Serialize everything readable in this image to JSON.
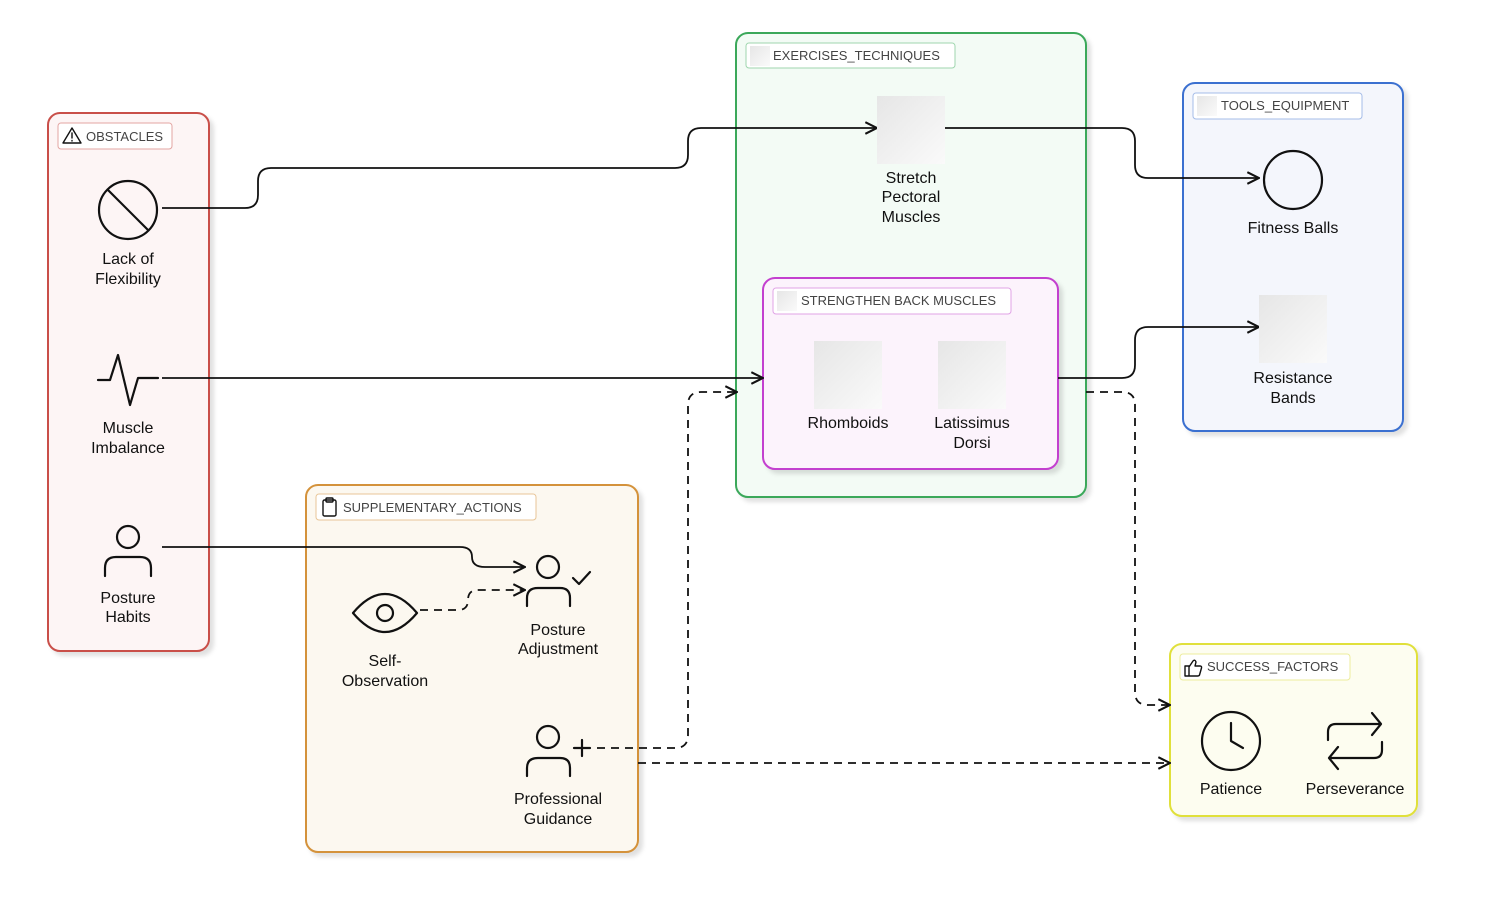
{
  "groups": {
    "obstacles": {
      "title": "OBSTACLES",
      "color": "#c9504a"
    },
    "exercises": {
      "title": "EXERCISES_TECHNIQUES",
      "color": "#3aa85a"
    },
    "strengthen": {
      "title": "STRENGTHEN BACK MUSCLES",
      "color": "#c33fcf"
    },
    "tools": {
      "title": "TOOLS_EQUIPMENT",
      "color": "#3a6fd0"
    },
    "supplementary": {
      "title": "SUPPLEMENTARY_ACTIONS",
      "color": "#d4923a"
    },
    "success": {
      "title": "SUCCESS_FACTORS",
      "color": "#e0e03a"
    }
  },
  "nodes": {
    "lack_flex": {
      "line1": "Lack of",
      "line2": "Flexibility",
      "icon": "prohibited-icon"
    },
    "muscle_imb": {
      "line1": "Muscle",
      "line2": "Imbalance",
      "icon": "pulse-icon"
    },
    "posture_habits": {
      "line1": "Posture",
      "line2": "Habits",
      "icon": "person-icon"
    },
    "stretch": {
      "line1": "Stretch",
      "line2": "Pectoral",
      "line3": "Muscles"
    },
    "rhomboids": {
      "line1": "Rhomboids"
    },
    "latissimus": {
      "line1": "Latissimus",
      "line2": "Dorsi"
    },
    "fitness_balls": {
      "line1": "Fitness Balls",
      "icon": "circle-icon"
    },
    "resistance_bands": {
      "line1": "Resistance",
      "line2": "Bands"
    },
    "self_obs": {
      "line1": "Self-",
      "line2": "Observation",
      "icon": "eye-icon"
    },
    "posture_adj": {
      "line1": "Posture",
      "line2": "Adjustment",
      "icon": "person-check-icon"
    },
    "prof_guidance": {
      "line1": "Professional",
      "line2": "Guidance",
      "icon": "person-plus-icon"
    },
    "patience": {
      "line1": "Patience",
      "icon": "clock-icon"
    },
    "perseverance": {
      "line1": "Perseverance",
      "icon": "repeat-icon"
    }
  }
}
